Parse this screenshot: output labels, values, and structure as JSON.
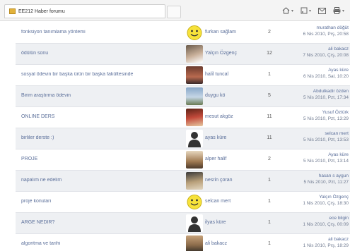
{
  "tab": {
    "title": "EE212 Haber forumu"
  },
  "colors": {
    "link": "#5b6f9a",
    "row_alt": "#eef0f3"
  },
  "rows": [
    {
      "topic": "fonksiyon tanımlama yöntemi",
      "author": "furkan sağlam",
      "count": "2",
      "last_by": "murathan döğüt",
      "last_date": "6 Nis 2010, Prş, 20:58",
      "avatar": "smiley-icon"
    },
    {
      "topic": "ödülün sonu",
      "author": "Yalçın Özgenç",
      "count": "12",
      "last_by": "ali bakacz",
      "last_date": "7 Nis 2010, Çrş, 20:08",
      "avatar": "photo"
    },
    {
      "topic": "sosyal ödevin bir başka ürün bir başka fakültesinde",
      "author": "halil tuncal",
      "count": "1",
      "last_by": "Ayas küre",
      "last_date": "6 Nis 2010, Sal, 10:20",
      "avatar": "photo"
    },
    {
      "topic": "Birim araştırma ödevin",
      "author": "duygu kö",
      "count": "5",
      "last_by": "Abdulkadir özden",
      "last_date": "5 Nis 2010, Pzt, 17:34",
      "avatar": "photo"
    },
    {
      "topic": "ONLINE DERS",
      "author": "mesut akgöz",
      "count": "11",
      "last_by": "Yusuf Öztürk",
      "last_date": "5 Nis 2010, Pzt, 13:29",
      "avatar": "photo"
    },
    {
      "topic": "birliler derste :)",
      "author": "ayas küre",
      "count": "11",
      "last_by": "selcan mert",
      "last_date": "5 Nis 2010, Pzt, 13:53",
      "avatar": "silhouette"
    },
    {
      "topic": "PROJE",
      "author": "alper halif",
      "count": "2",
      "last_by": "Ayas küre",
      "last_date": "5 Nis 2010, Pzt, 13:14",
      "avatar": "photo"
    },
    {
      "topic": "napalım ne edelim",
      "author": "nesrin çoran",
      "count": "1",
      "last_by": "hasan s aygun",
      "last_date": "5 Nis 2010, Pzt, 11:27",
      "avatar": "photo"
    },
    {
      "topic": "proje konuları",
      "author": "selcan mert",
      "count": "1",
      "last_by": "Yalçın Özgenç",
      "last_date": "1 Nis 2010, Çrş, 18:30",
      "avatar": "smiley-icon"
    },
    {
      "topic": "ARGE NEDİR?",
      "author": "ilyas küre",
      "count": "1",
      "last_by": "ece bilgin",
      "last_date": "1 Nis 2010, Çrş, 00:09",
      "avatar": "silhouette"
    },
    {
      "topic": "algoritma ve tarihi",
      "author": "ali bakacz",
      "count": "1",
      "last_by": "ali bakacz",
      "last_date": "1 Nis 2010, Prş, 18:29",
      "avatar": "photo"
    }
  ]
}
